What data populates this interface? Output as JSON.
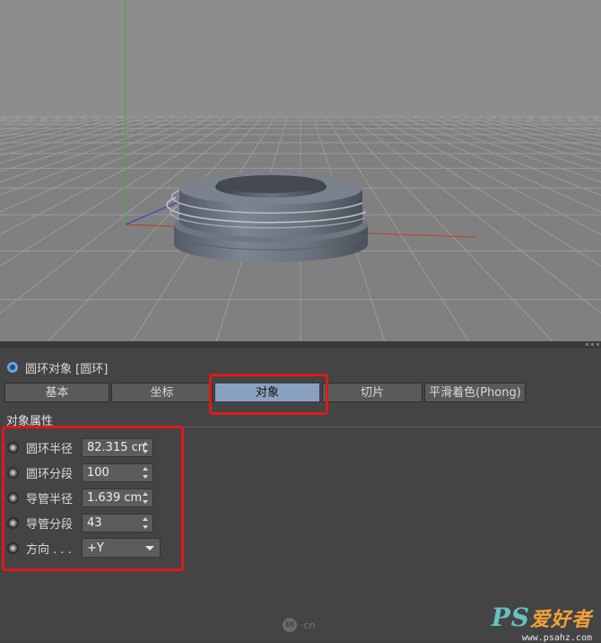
{
  "object_header": {
    "title": "圆环对象 [圆环]",
    "icon": "torus-icon"
  },
  "tabs": [
    {
      "label": "基本",
      "active": false
    },
    {
      "label": "坐标",
      "active": false
    },
    {
      "label": "对象",
      "active": true
    },
    {
      "label": "切片",
      "active": false
    },
    {
      "label": "平滑着色(Phong)",
      "active": false
    }
  ],
  "section": {
    "title": "对象属性"
  },
  "properties": [
    {
      "label": "圆环半径",
      "value": "82.315 cm",
      "control": "stepper"
    },
    {
      "label": "圆环分段",
      "value": "100",
      "control": "stepper"
    },
    {
      "label": "导管半径",
      "value": "1.639 cm",
      "control": "stepper"
    },
    {
      "label": "导管分段",
      "value": "43",
      "control": "stepper"
    },
    {
      "label": "方向 . . .",
      "value": "+Y",
      "control": "dropdown"
    }
  ],
  "watermark": {
    "text": "·cn",
    "logo": "UI"
  },
  "badge": {
    "ps": "PS",
    "cn": "爱好者",
    "url": "www.psahz.com"
  },
  "colors": {
    "active_tab": "#8aa0bf",
    "highlight_box": "#e01818",
    "viewport_bg": "#8c8c8c",
    "panel_bg": "#444444",
    "x_axis": "#c0392b",
    "y_axis": "#3cb043",
    "z_axis": "#2b3fd0"
  }
}
